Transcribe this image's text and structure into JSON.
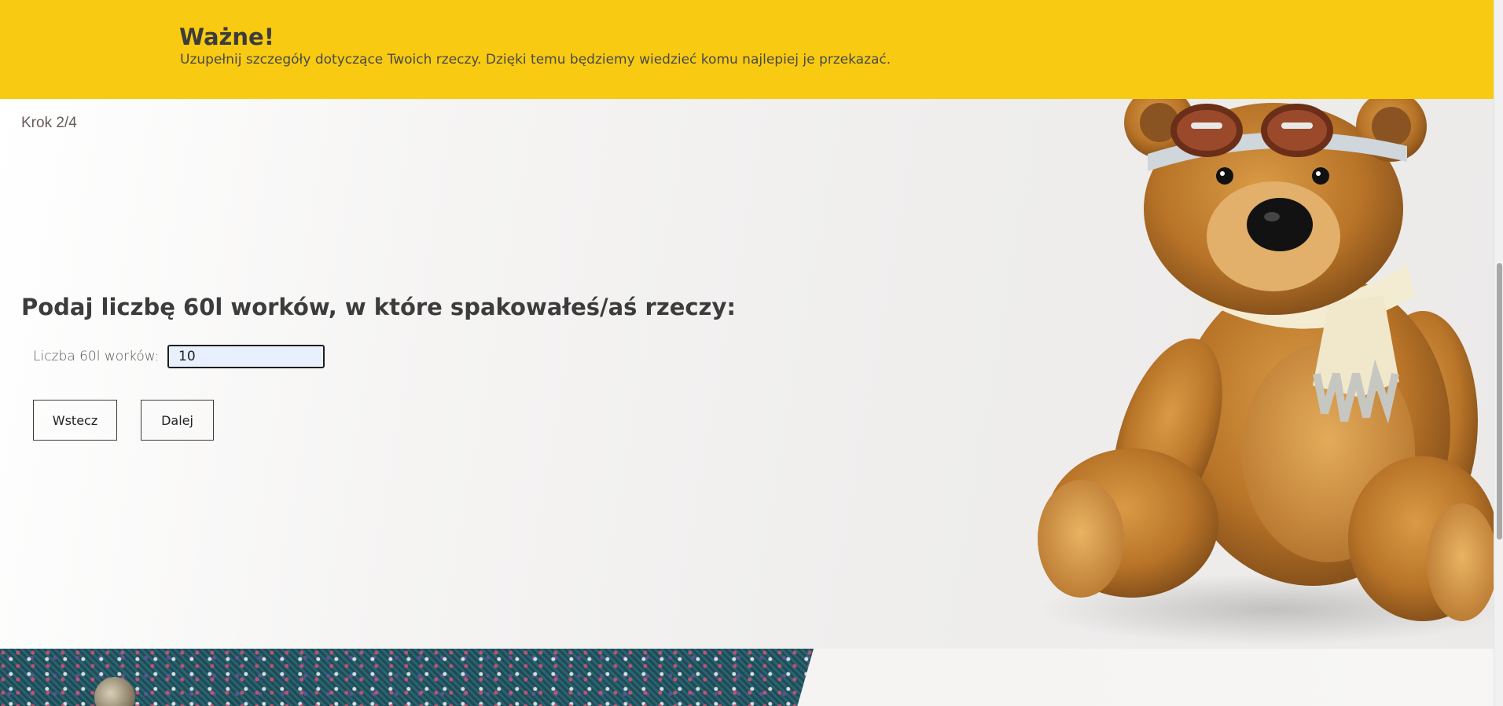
{
  "banner": {
    "title": "Ważne!",
    "text": "Uzupełnij szczegóły dotyczące Twoich rzeczy. Dzięki temu będziemy wiedzieć komu najlepiej je przekazać."
  },
  "form": {
    "step": "Krok 2/4",
    "question": "Podaj liczbę 60l worków, w które spakowałeś/aś rzeczy:",
    "field_label": "Liczba 60l worków:",
    "field_value": "10",
    "back_label": "Wstecz",
    "next_label": "Dalej"
  },
  "colors": {
    "banner": "#f8ca12",
    "text_dark": "#3c3c3c"
  },
  "icons": {
    "illustration": "teddy-bear-illustration",
    "bottom_image": "knit-fabric-image"
  }
}
